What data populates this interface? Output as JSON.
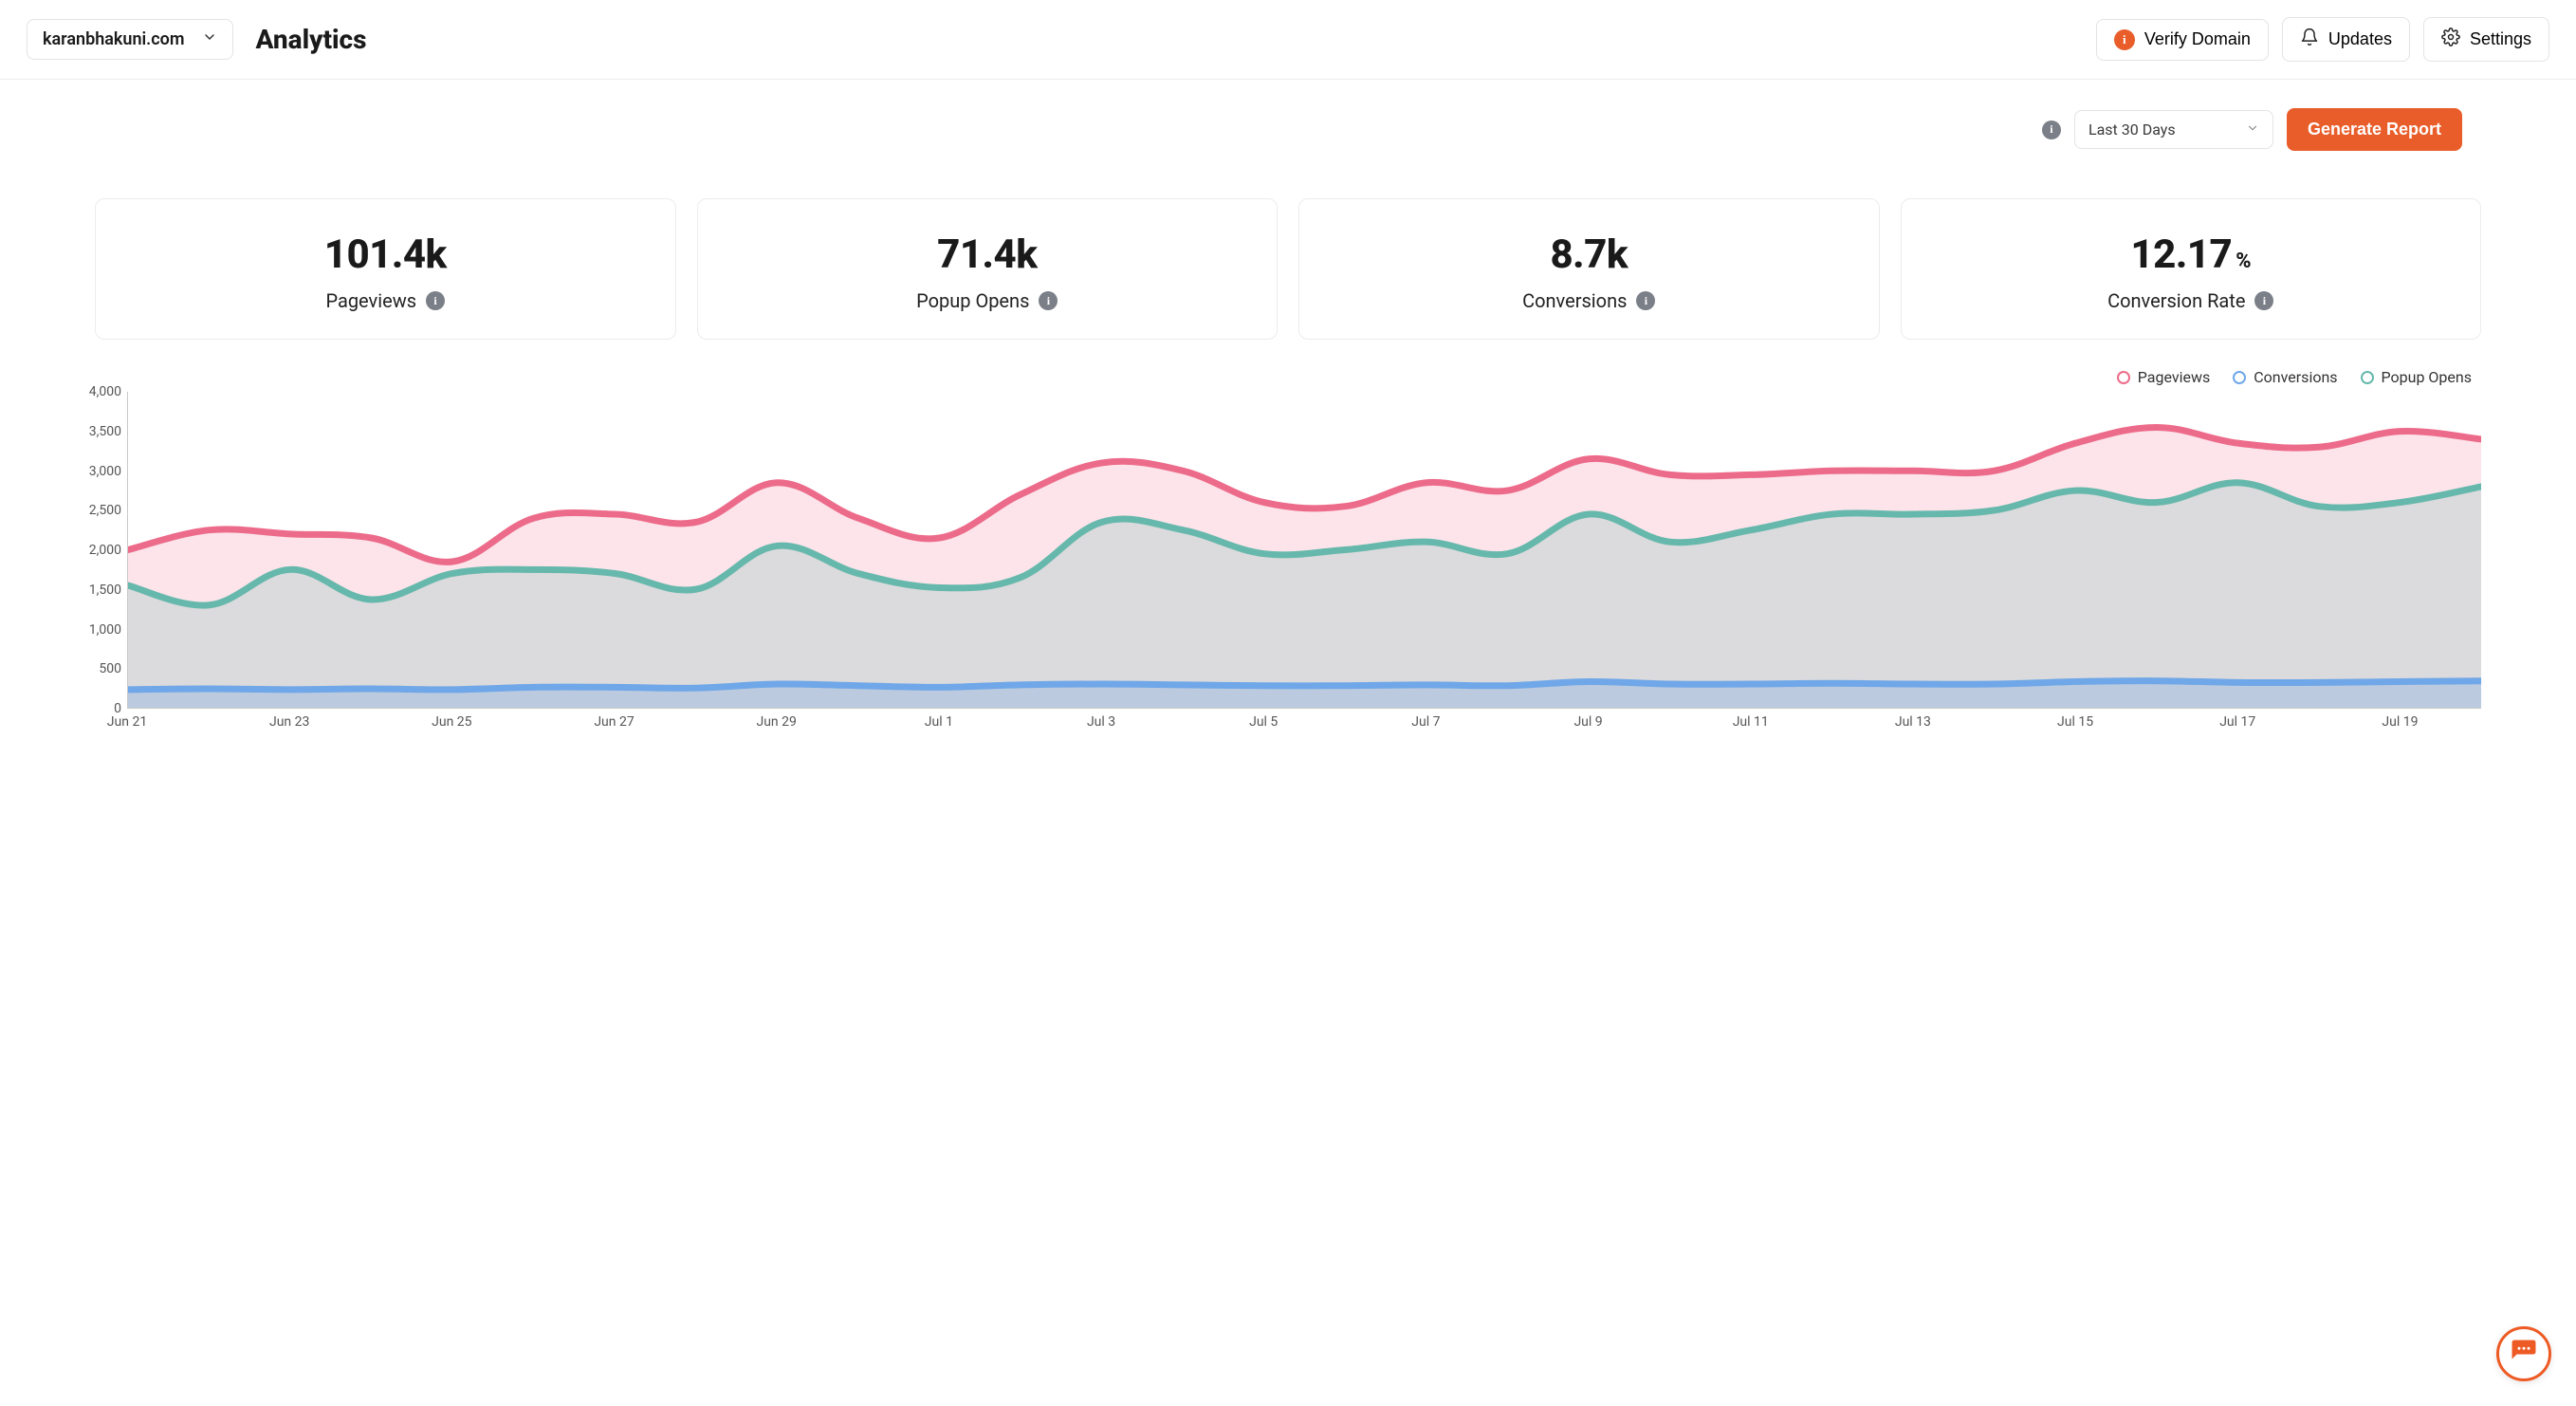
{
  "header": {
    "domain": "karanbhakuni.com",
    "title": "Analytics",
    "verify_label": "Verify Domain",
    "updates_label": "Updates",
    "settings_label": "Settings"
  },
  "controls": {
    "range_selected": "Last 30 Days",
    "generate_label": "Generate Report"
  },
  "stats": {
    "pageviews": {
      "value": "101.4k",
      "label": "Pageviews"
    },
    "popup_opens": {
      "value": "71.4k",
      "label": "Popup Opens"
    },
    "conversions": {
      "value": "8.7k",
      "label": "Conversions"
    },
    "conversion_rate": {
      "value": "12.17",
      "unit": "%",
      "label": "Conversion Rate"
    }
  },
  "legend": {
    "pageviews": "Pageviews",
    "conversions": "Conversions",
    "popup_opens": "Popup Opens"
  },
  "colors": {
    "pageviews": "#ed6b8a",
    "conversions": "#6fa7e8",
    "popup_opens": "#67b8ac",
    "accent": "#e95d2a"
  },
  "chart_data": {
    "type": "area",
    "xlabel": "",
    "ylabel": "",
    "ylim": [
      0,
      4000
    ],
    "y_ticks": [
      0,
      500,
      1000,
      1500,
      2000,
      2500,
      3000,
      3500,
      4000
    ],
    "x_tick_labels": [
      "Jun 21",
      "Jun 23",
      "Jun 25",
      "Jun 27",
      "Jun 29",
      "Jul 1",
      "Jul 3",
      "Jul 5",
      "Jul 7",
      "Jul 9",
      "Jul 11",
      "Jul 13",
      "Jul 15",
      "Jul 17",
      "Jul 19"
    ],
    "categories": [
      "Jun 21",
      "Jun 22",
      "Jun 23",
      "Jun 24",
      "Jun 25",
      "Jun 26",
      "Jun 27",
      "Jun 28",
      "Jun 29",
      "Jun 30",
      "Jul 1",
      "Jul 2",
      "Jul 3",
      "Jul 4",
      "Jul 5",
      "Jul 6",
      "Jul 7",
      "Jul 8",
      "Jul 9",
      "Jul 10",
      "Jul 11",
      "Jul 12",
      "Jul 13",
      "Jul 14",
      "Jul 15",
      "Jul 16",
      "Jul 17",
      "Jul 18",
      "Jul 19",
      "Jul 20"
    ],
    "series": [
      {
        "name": "Pageviews",
        "color": "#ed6b8a",
        "fill": "rgba(237,107,138,0.18)",
        "values": [
          2000,
          2250,
          2200,
          2150,
          1850,
          2400,
          2450,
          2350,
          2850,
          2400,
          2150,
          2700,
          3100,
          3000,
          2600,
          2550,
          2850,
          2750,
          3150,
          2950,
          2950,
          3000,
          3000,
          3000,
          3350,
          3550,
          3350,
          3300,
          3500,
          3400
        ]
      },
      {
        "name": "Popup Opens",
        "color": "#67b8ac",
        "fill": "rgba(103,184,172,0.22)",
        "values": [
          1550,
          1300,
          1750,
          1370,
          1700,
          1750,
          1700,
          1500,
          2050,
          1700,
          1520,
          1650,
          2350,
          2250,
          1950,
          2000,
          2100,
          1950,
          2450,
          2100,
          2250,
          2450,
          2450,
          2500,
          2750,
          2600,
          2850,
          2550,
          2600,
          2800
        ]
      },
      {
        "name": "Conversions",
        "color": "#6fa7e8",
        "fill": "rgba(111,167,232,0.30)",
        "values": [
          230,
          240,
          230,
          240,
          230,
          260,
          260,
          250,
          300,
          280,
          260,
          290,
          300,
          290,
          280,
          280,
          290,
          280,
          330,
          300,
          300,
          310,
          300,
          300,
          330,
          340,
          320,
          320,
          330,
          340
        ]
      }
    ]
  }
}
